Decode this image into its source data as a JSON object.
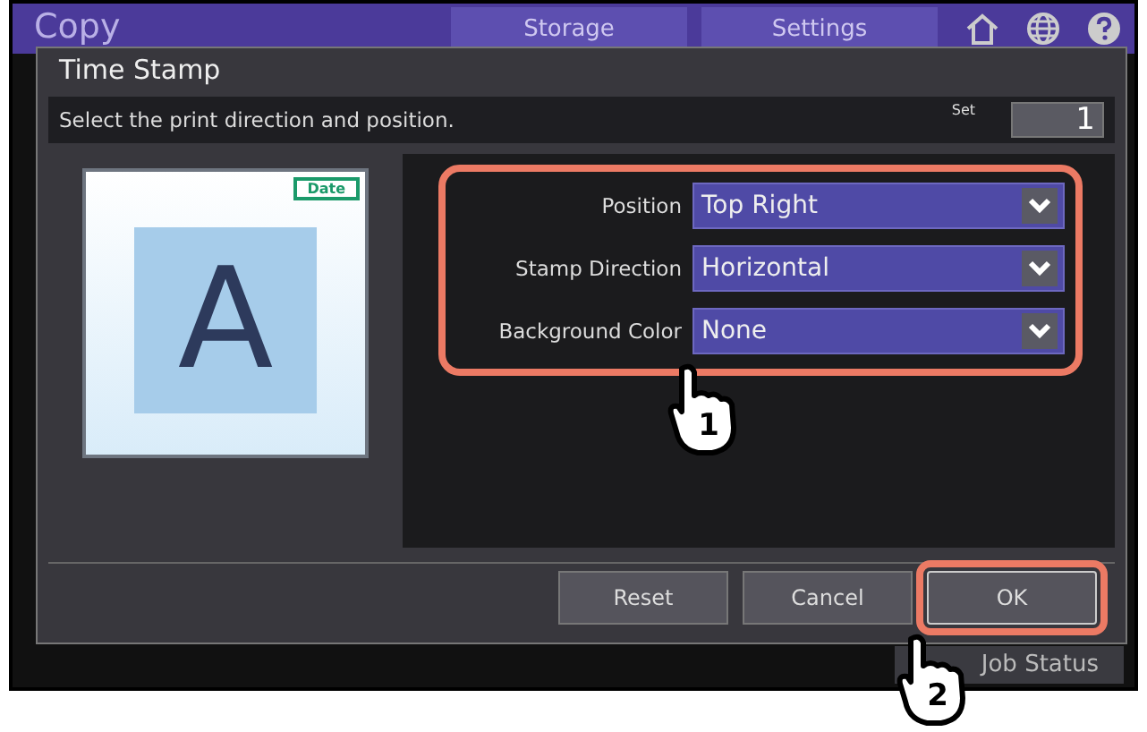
{
  "app_bar": {
    "title": "Copy",
    "tabs": [
      {
        "label": "Storage"
      },
      {
        "label": "Settings"
      }
    ]
  },
  "dialog": {
    "title": "Time Stamp",
    "instruction": "Select the print direction and position.",
    "set_label": "Set",
    "set_value": "1",
    "preview": {
      "stamp_label": "Date",
      "page_letter": "A"
    },
    "fields_highlighted": true,
    "fields": [
      {
        "label": "Position",
        "value": "Top Right"
      },
      {
        "label": "Stamp Direction",
        "value": "Horizontal"
      },
      {
        "label": "Background Color",
        "value": "None"
      }
    ],
    "buttons": [
      {
        "label": "Reset",
        "highlighted": false
      },
      {
        "label": "Cancel",
        "highlighted": false
      },
      {
        "label": "OK",
        "highlighted": true
      }
    ]
  },
  "status_button": "Job Status",
  "callouts": [
    {
      "number": "1"
    },
    {
      "number": "2"
    }
  ]
}
